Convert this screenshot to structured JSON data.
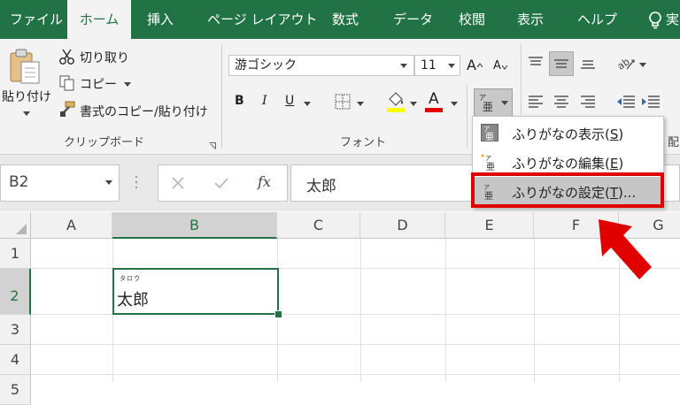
{
  "tabs": [
    "ファイル",
    "ホーム",
    "挿入",
    "ページ レイアウト",
    "数式",
    "データ",
    "校閲",
    "表示",
    "ヘルプ",
    "実"
  ],
  "active_tab": "ホーム",
  "clipboard": {
    "paste_label": "貼り付け",
    "cut_label": "切り取り",
    "copy_label": "コピー",
    "format_painter_label": "書式のコピー/貼り付け",
    "group_label": "クリップボード"
  },
  "font": {
    "font_name": "游ゴシック",
    "font_size": "11",
    "bold": "B",
    "italic": "I",
    "underline": "U",
    "font_color_letter": "A",
    "grow_letter": "A",
    "shrink_letter": "A",
    "group_label": "フォント",
    "font_color_bar": "#e00000",
    "fill_color_bar": "#ffff00"
  },
  "alignment": {
    "group_label_partial": "配"
  },
  "formula_bar": {
    "name_box": "B2",
    "fx_label": "fx",
    "content": "太郎"
  },
  "columns": [
    "A",
    "B",
    "C",
    "D",
    "E",
    "F",
    "G"
  ],
  "rows": [
    "1",
    "2",
    "3",
    "4",
    "5"
  ],
  "cell_b2": {
    "ruby": "タロウ",
    "value": "太郎"
  },
  "phonetic_menu": {
    "items": [
      {
        "label": "ふりがなの表示(",
        "key": "S",
        "tail": ")"
      },
      {
        "label": "ふりがなの編集(",
        "key": "E",
        "tail": ")"
      },
      {
        "label": "ふりがなの設定(",
        "key": "T",
        "tail": ")..."
      }
    ],
    "highlight_color": "#e00000"
  },
  "colors": {
    "accent_green": "#217346",
    "annotation_red": "#e00000"
  }
}
